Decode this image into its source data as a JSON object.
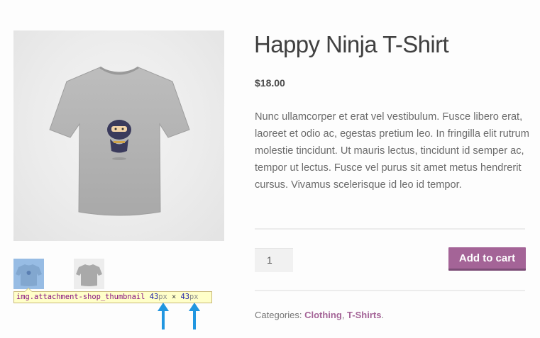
{
  "product": {
    "title": "Happy Ninja T-Shirt",
    "price": "$18.00",
    "description": "Nunc ullamcorper et erat vel vestibulum. Fusce libero erat, laoreet et odio ac, egestas pretium leo. In fringilla elit rutrum molestie tincidunt. Ut mauris lectus, tincidunt id semper ac, tempor ut lectus. Fusce vel purus sit amet metus hendrerit cursus. Vivamus scelerisque id leo id tempor.",
    "main_image_icon": "tshirt-ninja-image"
  },
  "cart": {
    "quantity": "1",
    "add_label": "Add to cart"
  },
  "meta": {
    "categories_label": "Categories: ",
    "categories": [
      "Clothing",
      "T-Shirts"
    ],
    "separator": ", ",
    "end": "."
  },
  "devtools_tooltip": {
    "selector": "img.attachment-shop_thumbnail",
    "width": "43",
    "height": "43",
    "unit": "px",
    "times": "×"
  },
  "colors": {
    "accent": "#a46497",
    "highlight": "#64a0e1",
    "arrow": "#2196e0"
  }
}
